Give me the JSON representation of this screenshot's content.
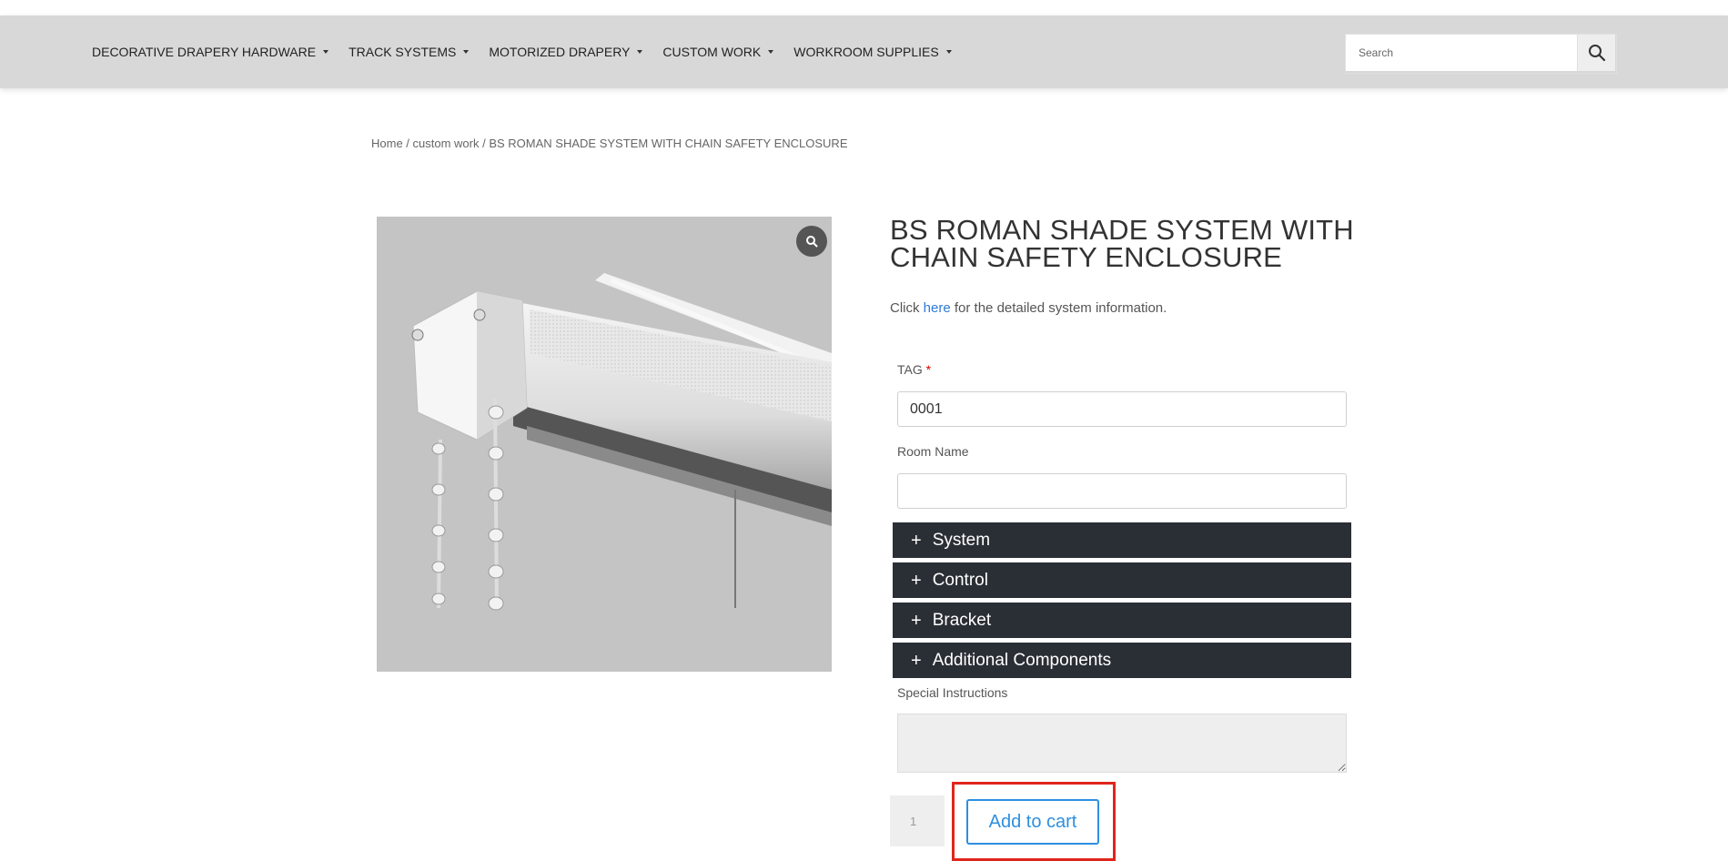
{
  "nav": {
    "items": [
      {
        "label": "DECORATIVE DRAPERY HARDWARE"
      },
      {
        "label": "TRACK SYSTEMS"
      },
      {
        "label": "MOTORIZED DRAPERY"
      },
      {
        "label": "CUSTOM WORK"
      },
      {
        "label": "WORKROOM SUPPLIES"
      }
    ],
    "search_placeholder": "Search",
    "search_icon": "magnifier-icon"
  },
  "breadcrumb": {
    "home": "Home",
    "sep1": " / ",
    "category": "custom work",
    "sep2": " / ",
    "current": "BS ROMAN SHADE SYSTEM WITH CHAIN SAFETY ENCLOSURE"
  },
  "product": {
    "title_line1": "BS ROMAN SHADE SYSTEM WITH",
    "title_line2": "CHAIN SAFETY ENCLOSURE",
    "info_prefix": "Click ",
    "info_link": "here",
    "info_suffix": " for the detailed system information.",
    "zoom_icon": "zoom-icon"
  },
  "form": {
    "tag_label": "TAG",
    "required_mark": "*",
    "tag_value": "0001",
    "room_label": "Room Name",
    "room_value": "",
    "accordions": [
      {
        "label": "System",
        "icon": "plus-icon"
      },
      {
        "label": "Control",
        "icon": "plus-icon"
      },
      {
        "label": "Bracket",
        "icon": "plus-icon"
      },
      {
        "label": "Additional Components",
        "icon": "plus-icon"
      }
    ],
    "special_label": "Special Instructions",
    "special_value": "",
    "quantity": "1",
    "add_to_cart": "Add to cart"
  },
  "colors": {
    "navbar_bg": "#d8d8d8",
    "accordion_bg": "#2a2e35",
    "link": "#2e7bd6",
    "button_accent": "#2e8fe0",
    "highlight": "#e0261c"
  }
}
